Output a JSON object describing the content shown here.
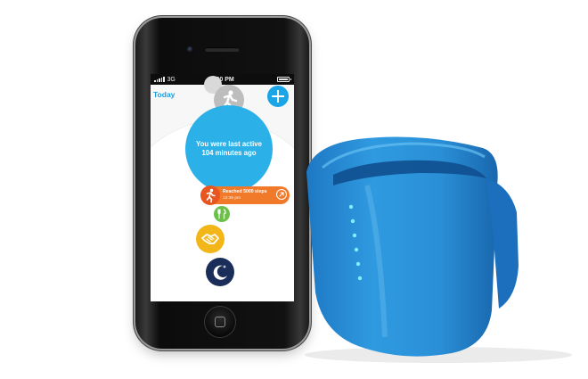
{
  "phone": {
    "status_bar": {
      "network": "3G",
      "time": "2:00 PM"
    },
    "app": {
      "nav_title": "Today",
      "add_button_label": "+",
      "activity_bubble": {
        "line1": "You were last active",
        "line2": "104 minutes ago"
      },
      "event_card": {
        "title": "Reached 5000 steps",
        "time": "12:35 pm"
      },
      "icons": [
        "running-icon",
        "meal-icon",
        "handshake-icon",
        "sleep-moon-icon"
      ]
    }
  },
  "colors": {
    "accent_blue": "#2bb1e8",
    "step_orange": "#f07a2a",
    "meal_green": "#6cc04a",
    "social_yellow": "#f2b619",
    "sleep_navy": "#1b2e5a",
    "band_blue": "#2a8fd6",
    "band_led": "#7ff0ff"
  }
}
